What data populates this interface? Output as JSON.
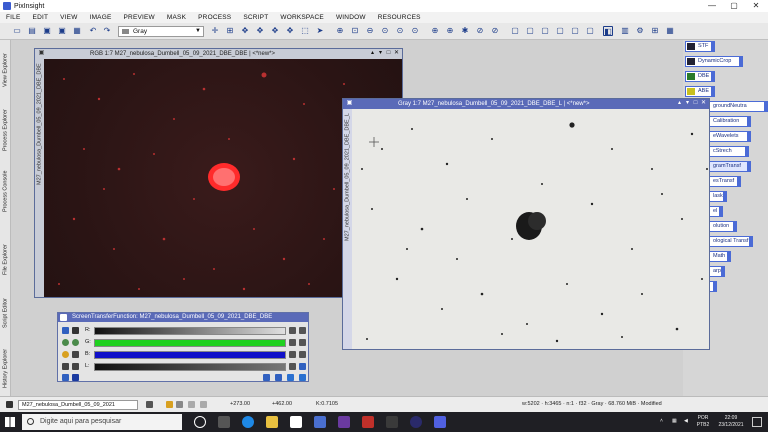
{
  "app": {
    "title": "PixInsight",
    "window_controls": [
      "—",
      "▢",
      "✕"
    ]
  },
  "menu": [
    "FILE",
    "EDIT",
    "VIEW",
    "IMAGE",
    "PREVIEW",
    "MASK",
    "PROCESS",
    "SCRIPT",
    "WORKSPACE",
    "WINDOW",
    "RESOURCES"
  ],
  "toolbar": {
    "channel_select": "Gray"
  },
  "side_tabs": [
    "View Explorer",
    "Process Explorer",
    "Process Console",
    "File Explorer",
    "Script Editor",
    "History Explorer"
  ],
  "process_icons": [
    "STF",
    "DynamicCrop",
    "DBE",
    "ABE",
    "groundNeutra",
    "Calibration",
    "eWavelets",
    "cStrech",
    "gramTransf",
    "esTransf",
    "lask",
    "el",
    "olution",
    "ological Transf",
    "Math",
    "arp"
  ],
  "windows": {
    "rgb": {
      "title": "RGB 1:7 M27_nebulosa_Dumbell_05_09_2021_DBE_DBE | <*new*>",
      "side_label": "M27_nebulosa_Dumbell_05_09_2021_DBE_DBE"
    },
    "gray": {
      "title": "Gray 1:7 M27_nebulosa_Dumbell_05_09_2021_DBE_DBE_L | <*new*>",
      "side_label": "M27_nebulosa_Dumbell_05_09_2021_DBE_DBE_L"
    }
  },
  "stf": {
    "title": "ScreenTransferFunction: M27_nebulosa_Dumbell_05_09_2021_DBE_DBE",
    "channels": [
      "R:",
      "G:",
      "B:",
      "L:"
    ],
    "colors": {
      "R": "#8b0000",
      "G": "#1fd01f",
      "B": "#1010c8",
      "L": "#888888"
    }
  },
  "status": {
    "view": "M27_nebulosa_Dumbell_05_09_2021",
    "x": "+273.00",
    "y": "+462.00",
    "k": "K:0.7105",
    "info": "w:5202 · h:3465 · n:1 · f32 · Gray · 68.760 MiB · Modified"
  },
  "taskbar": {
    "search_placeholder": "Digite aqui para pesquisar",
    "lang": "POR",
    "layout": "PTB2",
    "time": "22:09",
    "date": "23/12/2021"
  }
}
